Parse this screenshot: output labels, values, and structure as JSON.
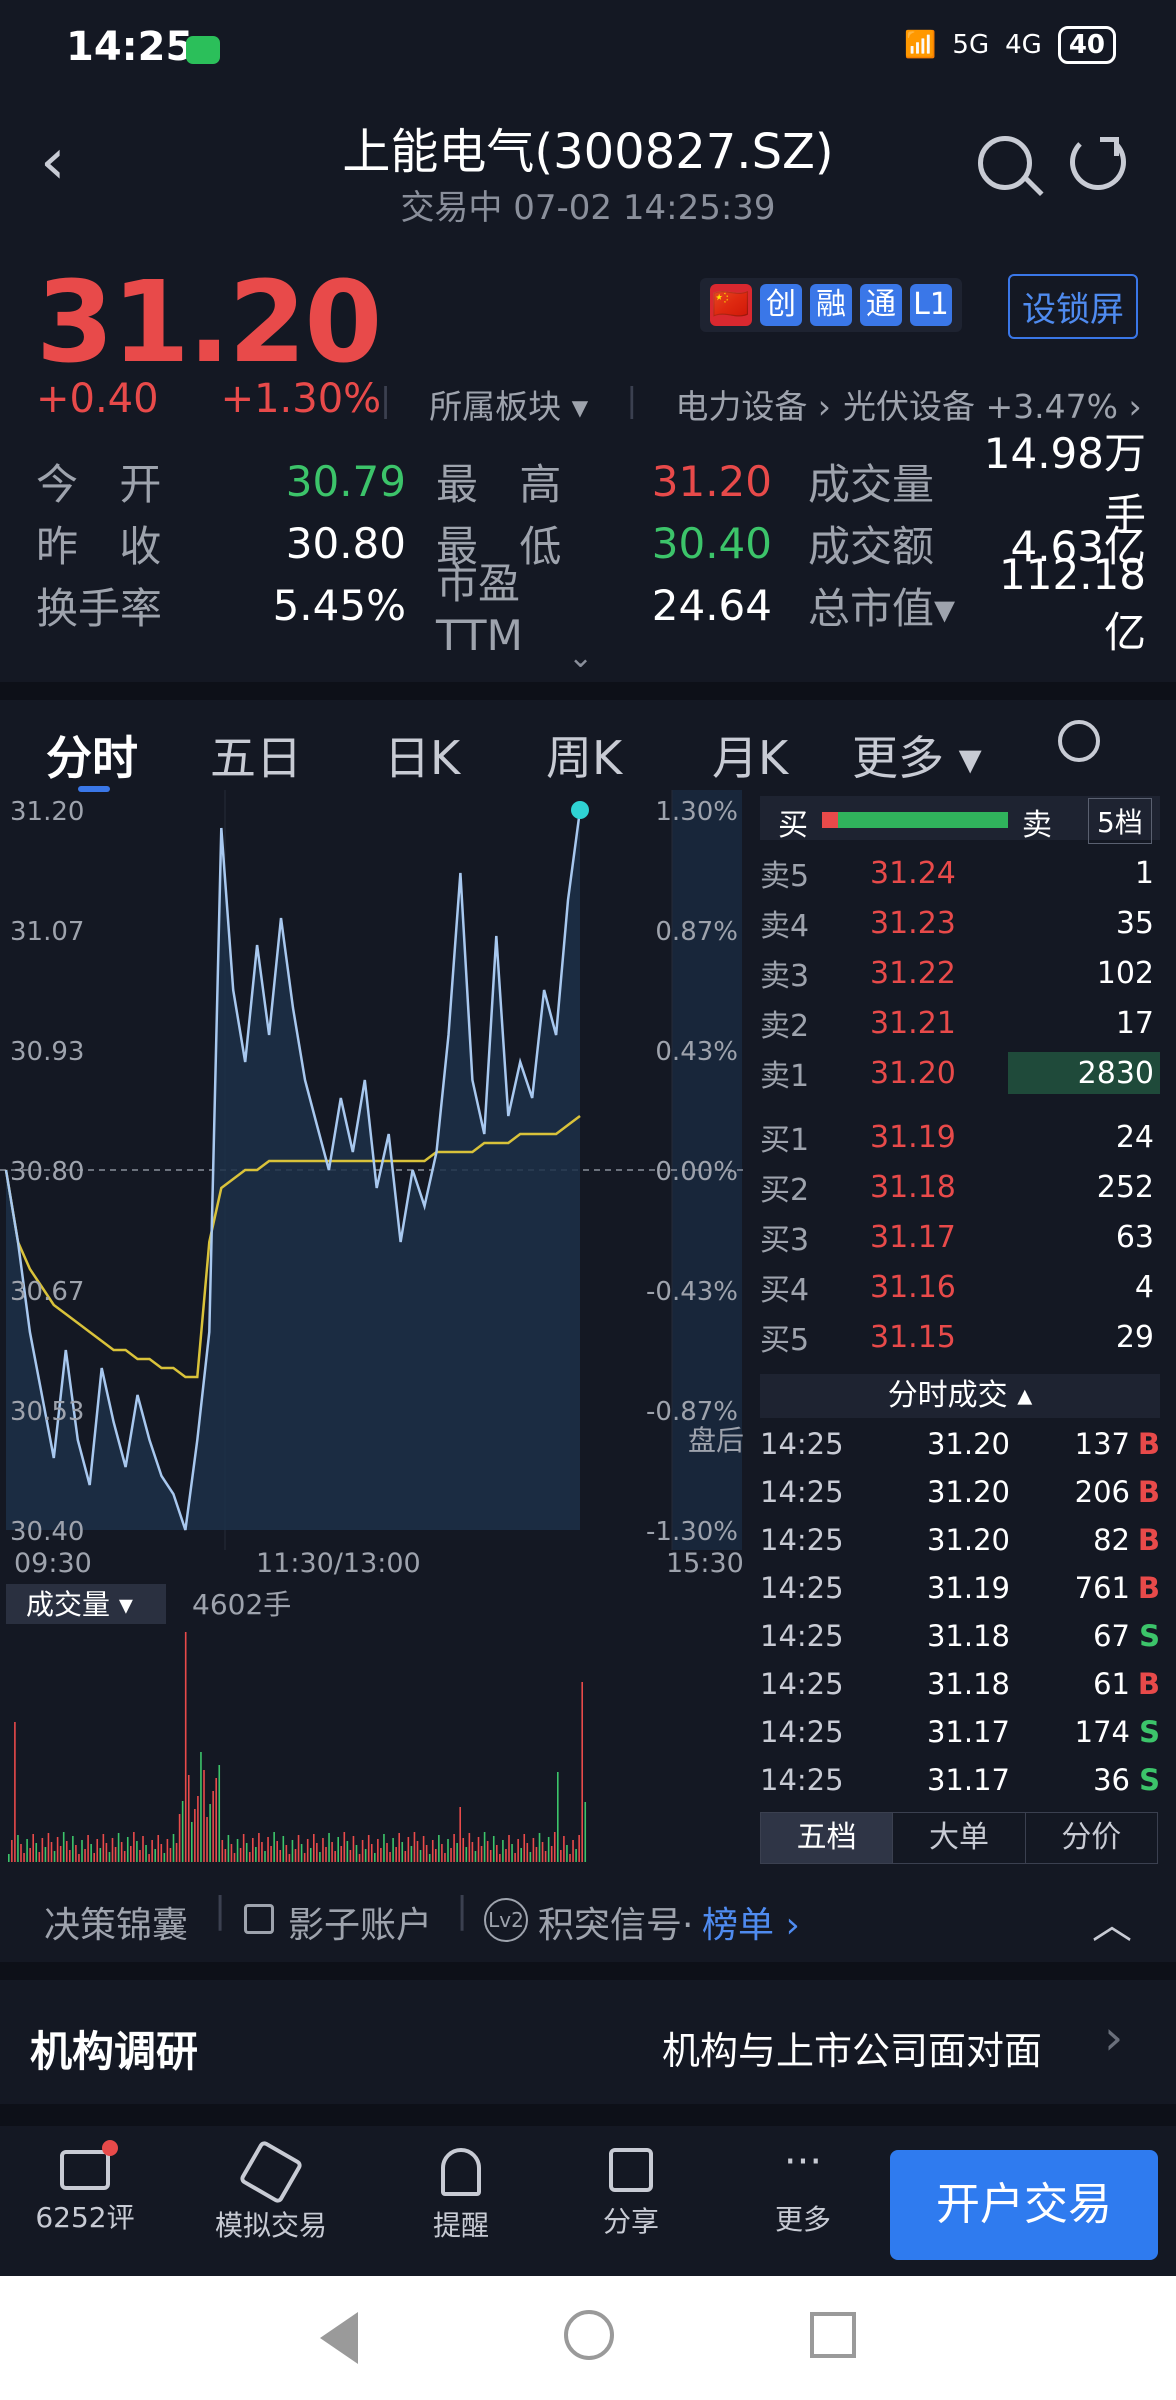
{
  "status": {
    "time": "14:25",
    "signal1": "5G",
    "signal2": "4G",
    "battery": "40"
  },
  "header": {
    "title": "上能电气(300827.SZ)",
    "subtitle": "交易中 07-02 14:25:39"
  },
  "quote": {
    "price": "31.20",
    "change": "+0.40",
    "change_pct": "+1.30%",
    "sector_label": "所属板块 ▾",
    "sector1": "电力设备 ›",
    "sector2": "光伏设备 +3.47% ›",
    "badges": [
      "🇨🇳",
      "创",
      "融",
      "通",
      "L1"
    ],
    "lock_label": "设锁屏",
    "stats": [
      {
        "k1": "今 开",
        "v1": "30.79",
        "k2": "最 高",
        "v2": "31.20",
        "k3": "成交量",
        "v3": "14.98万手"
      },
      {
        "k1": "昨 收",
        "v1": "30.80",
        "k2": "最 低",
        "v2": "30.40",
        "k3": "成交额",
        "v3": "4.63亿"
      },
      {
        "k1": "换手率",
        "v1": "5.45%",
        "k2": "市盈TTM",
        "v2": "24.64",
        "k3": "总市值▾",
        "v3": "112.18亿"
      }
    ]
  },
  "tabs": [
    "分时",
    "五日",
    "日K",
    "周K",
    "月K",
    "更多 ▾"
  ],
  "chart_data": {
    "type": "line",
    "title": "",
    "xlabel": "",
    "ylabel": "",
    "x_ticks": [
      "09:30",
      "11:30/13:00",
      "15:30"
    ],
    "y_ticks": [
      "31.20",
      "31.07",
      "30.93",
      "30.80",
      "30.67",
      "30.53",
      "30.40"
    ],
    "pct_ticks": [
      "1.30%",
      "0.87%",
      "0.43%",
      "0.00%",
      "-0.43%",
      "-0.87%",
      "-1.30%"
    ],
    "ylim": [
      30.4,
      31.2
    ],
    "prev_close": 30.8,
    "after_hours_label": "盘后",
    "series": [
      {
        "values": [
          30.8,
          30.72,
          30.62,
          30.55,
          30.48,
          30.6,
          30.5,
          30.45,
          30.58,
          30.52,
          30.47,
          30.55,
          30.5,
          30.46,
          30.44,
          30.4,
          30.5,
          30.62,
          31.18,
          31.0,
          30.92,
          31.05,
          30.95,
          31.08,
          30.98,
          30.9,
          30.85,
          30.8,
          30.88,
          30.82,
          30.9,
          30.78,
          30.84,
          30.72,
          30.8,
          30.76,
          30.82,
          30.95,
          31.13,
          30.9,
          30.84,
          31.06,
          30.86,
          30.92,
          30.88,
          31.0,
          30.95,
          31.1,
          31.2
        ]
      },
      {
        "values": [
          30.8,
          30.72,
          30.69,
          30.67,
          30.65,
          30.64,
          30.63,
          30.62,
          30.61,
          30.6,
          30.6,
          30.59,
          30.59,
          30.58,
          30.58,
          30.57,
          30.57,
          30.72,
          30.78,
          30.79,
          30.8,
          30.8,
          30.81,
          30.81,
          30.81,
          30.81,
          30.81,
          30.81,
          30.81,
          30.81,
          30.81,
          30.81,
          30.81,
          30.81,
          30.81,
          30.81,
          30.82,
          30.82,
          30.82,
          30.82,
          30.83,
          30.83,
          30.83,
          30.84,
          30.84,
          30.84,
          30.84,
          30.85,
          30.86
        ]
      }
    ],
    "volume_label": "成交量 ▾",
    "volume_value": "4602手"
  },
  "book": {
    "buy_label": "买",
    "sell_label": "卖",
    "level_btn": "5档",
    "asks": [
      {
        "l": "卖5",
        "p": "31.24",
        "q": "1"
      },
      {
        "l": "卖4",
        "p": "31.23",
        "q": "35"
      },
      {
        "l": "卖3",
        "p": "31.22",
        "q": "102"
      },
      {
        "l": "卖2",
        "p": "31.21",
        "q": "17"
      },
      {
        "l": "卖1",
        "p": "31.20",
        "q": "2830"
      }
    ],
    "bids": [
      {
        "l": "买1",
        "p": "31.19",
        "q": "24"
      },
      {
        "l": "买2",
        "p": "31.18",
        "q": "252"
      },
      {
        "l": "买3",
        "p": "31.17",
        "q": "63"
      },
      {
        "l": "买4",
        "p": "31.16",
        "q": "4"
      },
      {
        "l": "买5",
        "p": "31.15",
        "q": "29"
      }
    ],
    "trades_title": "分时成交 ▴",
    "trades": [
      {
        "t": "14:25",
        "p": "31.20",
        "q": "137",
        "f": "B"
      },
      {
        "t": "14:25",
        "p": "31.20",
        "q": "206",
        "f": "B"
      },
      {
        "t": "14:25",
        "p": "31.20",
        "q": "82",
        "f": "B"
      },
      {
        "t": "14:25",
        "p": "31.19",
        "q": "761",
        "f": "B"
      },
      {
        "t": "14:25",
        "p": "31.18",
        "q": "67",
        "f": "S"
      },
      {
        "t": "14:25",
        "p": "31.18",
        "q": "61",
        "f": "B"
      },
      {
        "t": "14:25",
        "p": "31.17",
        "q": "174",
        "f": "S"
      },
      {
        "t": "14:25",
        "p": "31.17",
        "q": "36",
        "f": "S"
      }
    ],
    "bottom_tabs": [
      "五档",
      "大单",
      "分价"
    ]
  },
  "strip": {
    "a": "决策锦囊",
    "b": "影子账户",
    "c": "积突信号·",
    "d": "榜单 ›",
    "lv": "Lv2"
  },
  "inst": {
    "title": "机构调研",
    "desc": "机构与上市公司面对面"
  },
  "nav": [
    {
      "label": "6252评"
    },
    {
      "label": "模拟交易"
    },
    {
      "label": "提醒"
    },
    {
      "label": "分享"
    },
    {
      "label": "更多"
    }
  ],
  "open_btn": "开户交易"
}
